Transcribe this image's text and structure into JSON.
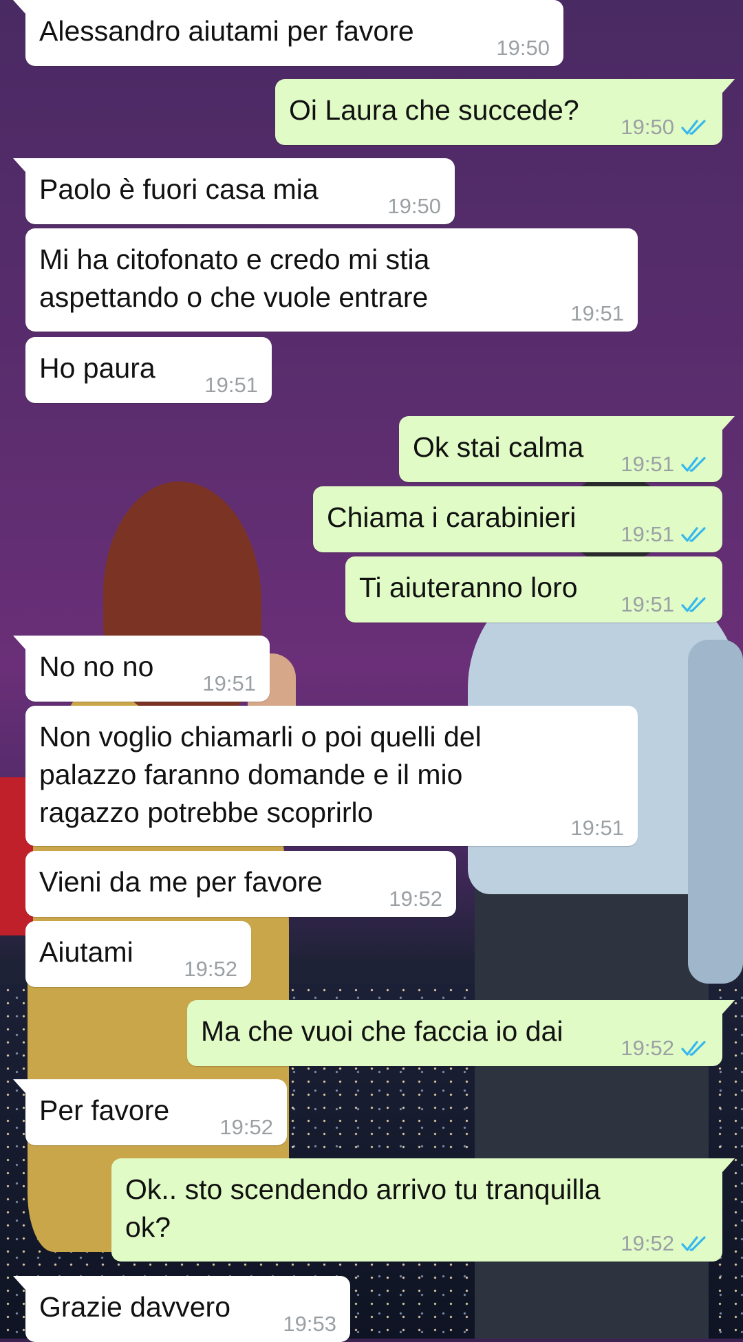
{
  "colors": {
    "incoming_bubble": "#ffffff",
    "outgoing_bubble": "#e0fbc5",
    "read_ticks": "#34b7f1",
    "timestamp": "#9ba0a4"
  },
  "icons": {
    "read_receipt": "double-check-icon"
  },
  "messages": [
    {
      "direction": "in",
      "text": "Alessandro aiutami per favore",
      "time": "19:50"
    },
    {
      "direction": "out",
      "text": "Oi Laura che succede?",
      "time": "19:50",
      "status": "read"
    },
    {
      "direction": "in",
      "text": "Paolo è fuori casa mia",
      "time": "19:50"
    },
    {
      "direction": "in",
      "line1": "Mi ha citofonato e credo mi stia",
      "line2": "aspettando o che vuole entrare",
      "time": "19:51"
    },
    {
      "direction": "in",
      "text": "Ho paura",
      "time": "19:51"
    },
    {
      "direction": "out",
      "text": "Ok stai calma",
      "time": "19:51",
      "status": "read"
    },
    {
      "direction": "out",
      "text": "Chiama i carabinieri",
      "time": "19:51",
      "status": "read"
    },
    {
      "direction": "out",
      "text": "Ti aiuteranno loro",
      "time": "19:51",
      "status": "read"
    },
    {
      "direction": "in",
      "text": "No no no",
      "time": "19:51"
    },
    {
      "direction": "in",
      "line1": "Non voglio chiamarli o poi quelli del",
      "line2": "palazzo faranno domande e il mio",
      "line3": "ragazzo potrebbe scoprirlo",
      "time": "19:51"
    },
    {
      "direction": "in",
      "text": "Vieni da me per favore",
      "time": "19:52"
    },
    {
      "direction": "in",
      "text": "Aiutami",
      "time": "19:52"
    },
    {
      "direction": "out",
      "text": "Ma che vuoi che faccia io dai",
      "time": "19:52",
      "status": "read"
    },
    {
      "direction": "in",
      "text": "Per favore",
      "time": "19:52"
    },
    {
      "direction": "out",
      "line1": "Ok.. sto scendendo arrivo tu tranquilla",
      "line2": "ok?",
      "time": "19:52",
      "status": "read"
    },
    {
      "direction": "in",
      "text": "Grazie davvero",
      "time": "19:53"
    }
  ]
}
